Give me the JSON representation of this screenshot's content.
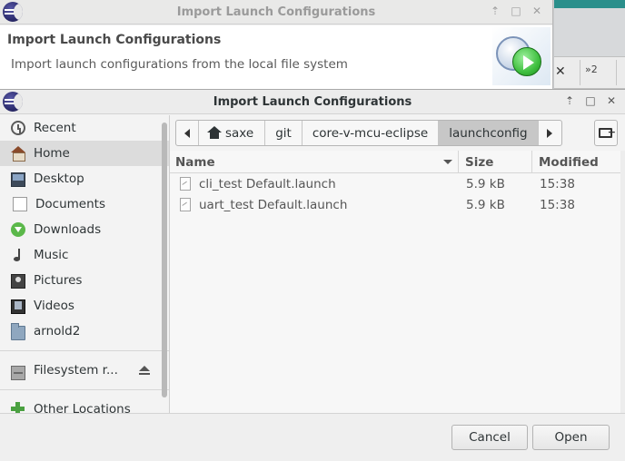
{
  "background_window": {
    "title": "Import Launch Configurations",
    "header_title": "Import Launch Configurations",
    "header_description": "Import launch configurations from the local file system"
  },
  "background_toolbar": {
    "more_label": "»2"
  },
  "dialog": {
    "title": "Import Launch Configurations"
  },
  "sidebar": {
    "places": [
      {
        "label": "Recent",
        "icon": "recent-icon"
      },
      {
        "label": "Home",
        "icon": "home-icon"
      },
      {
        "label": "Desktop",
        "icon": "desktop-icon"
      },
      {
        "label": "Documents",
        "icon": "documents-icon"
      },
      {
        "label": "Downloads",
        "icon": "downloads-icon"
      },
      {
        "label": "Music",
        "icon": "music-icon"
      },
      {
        "label": "Pictures",
        "icon": "pictures-icon"
      },
      {
        "label": "Videos",
        "icon": "videos-icon"
      },
      {
        "label": "arnold2",
        "icon": "folder-icon"
      }
    ],
    "filesystem_label": "Filesystem r...",
    "other_locations_label": "Other Locations"
  },
  "pathbar": {
    "segments": [
      "saxe",
      "git",
      "core-v-mcu-eclipse",
      "launchconfig"
    ]
  },
  "filelist": {
    "columns": {
      "name": "Name",
      "size": "Size",
      "modified": "Modified"
    },
    "rows": [
      {
        "name": "cli_test Default.launch",
        "size": "5.9 kB",
        "modified": "15:38"
      },
      {
        "name": "uart_test Default.launch",
        "size": "5.9 kB",
        "modified": "15:38"
      }
    ]
  },
  "buttons": {
    "cancel": "Cancel",
    "open": "Open"
  },
  "colors": {
    "accent_teal": "#2a8f8b",
    "selected_path": "#c7c7c7",
    "selected_place": "#dcdcdc"
  }
}
